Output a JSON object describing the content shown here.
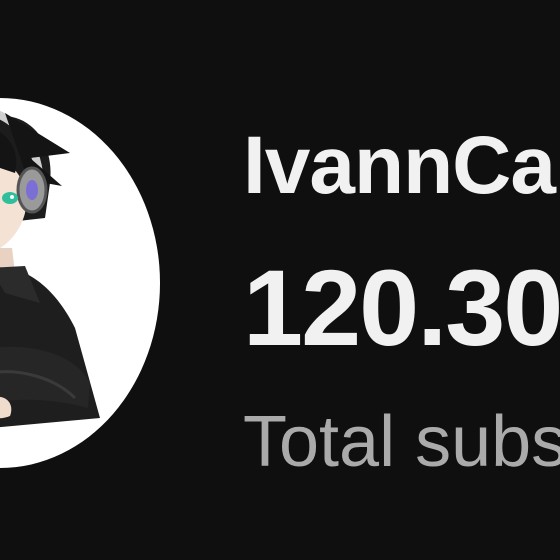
{
  "channel": {
    "name": "IvannCa",
    "subscriber_count": "120.30",
    "subscriber_label": "Total subs"
  },
  "avatar": {
    "icon": "channel-avatar-anime-character-icon",
    "background": "#ffffff"
  },
  "colors": {
    "page_background": "#0f0f0f",
    "primary_text": "#f1f1f1",
    "secondary_text": "#aaaaaa"
  }
}
